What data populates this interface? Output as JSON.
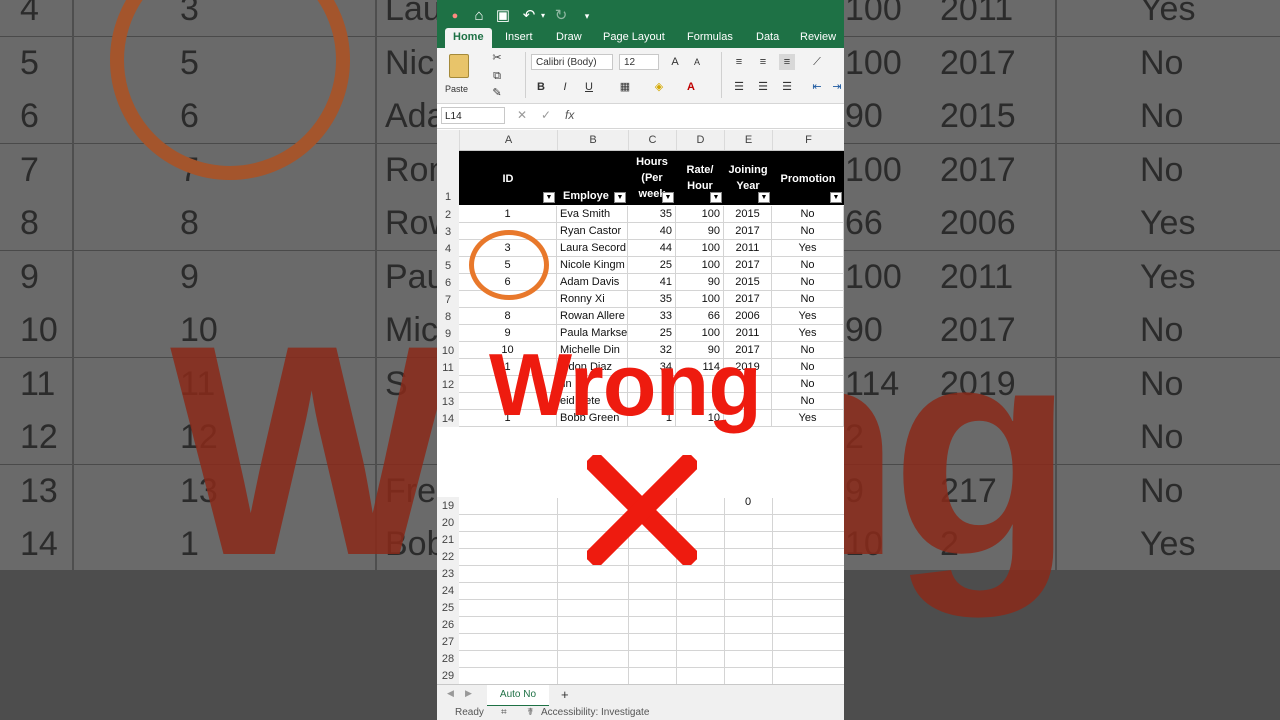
{
  "background": {
    "rows": [
      {
        "row": "4",
        "id": "3",
        "name": "Lau",
        "rate": "100",
        "year": "2011",
        "promo": "Yes"
      },
      {
        "row": "5",
        "id": "5",
        "name": "Nic",
        "rate": "100",
        "year": "2017",
        "promo": "No"
      },
      {
        "row": "6",
        "id": "6",
        "name": "Ada",
        "rate": "90",
        "year": "2015",
        "promo": "No"
      },
      {
        "row": "7",
        "id": "7",
        "name": "Ron",
        "rate": "100",
        "year": "2017",
        "promo": "No"
      },
      {
        "row": "8",
        "id": "8",
        "name": "Row",
        "rate": "66",
        "year": "2006",
        "promo": "Yes"
      },
      {
        "row": "9",
        "id": "9",
        "name": "Pau",
        "rate": "100",
        "year": "2011",
        "promo": "Yes"
      },
      {
        "row": "10",
        "id": "10",
        "name": "Mic",
        "rate": "90",
        "year": "2017",
        "promo": "No"
      },
      {
        "row": "11",
        "id": "11",
        "name": "S",
        "rate": "114",
        "year": "2019",
        "promo": "No"
      },
      {
        "row": "12",
        "id": "12",
        "name": "",
        "rate": "2",
        "year": "",
        "promo": "No"
      },
      {
        "row": "13",
        "id": "13",
        "name": "Fre",
        "rate": "9",
        "year": "217",
        "promo": "No"
      },
      {
        "row": "14",
        "id": "1",
        "name": "Bob",
        "rate": "10",
        "year": "2",
        "promo": "Yes"
      }
    ],
    "big_text": "Wrong"
  },
  "tabs": [
    "Home",
    "Insert",
    "Draw",
    "Page Layout",
    "Formulas",
    "Data",
    "Review"
  ],
  "ribbon": {
    "paste_label": "Paste",
    "font_name": "Calibri (Body)",
    "font_size": "12",
    "bold": "B",
    "italic": "I",
    "underline": "U"
  },
  "formula_bar": {
    "name_box": "L14",
    "fx": "fx"
  },
  "columns": [
    "A",
    "B",
    "C",
    "D",
    "E",
    "F"
  ],
  "header": {
    "id": "ID",
    "employee": "Employe",
    "hours_l1": "Hours",
    "hours_l2": "(Per",
    "hours_l3": "week",
    "rate_l1": "Rate/",
    "rate_l2": "Hour",
    "join_l1": "Joining",
    "join_l2": "Year",
    "promotion": "Promotion"
  },
  "row_numbers": [
    "1",
    "2",
    "3",
    "4",
    "5",
    "6",
    "7",
    "8",
    "9",
    "10",
    "11",
    "12",
    "13",
    "14",
    "19",
    "20",
    "21",
    "22",
    "23",
    "24",
    "25",
    "26",
    "27",
    "28",
    "29"
  ],
  "rows": [
    {
      "id": "1",
      "name": "Eva Smith",
      "hours": "35",
      "rate": "100",
      "year": "2015",
      "promo": "No"
    },
    {
      "id": "",
      "name": "Ryan Castor",
      "hours": "40",
      "rate": "90",
      "year": "2017",
      "promo": "No"
    },
    {
      "id": "3",
      "name": "Laura Secord",
      "hours": "44",
      "rate": "100",
      "year": "2011",
      "promo": "Yes"
    },
    {
      "id": "5",
      "name": "Nicole Kingm",
      "hours": "25",
      "rate": "100",
      "year": "2017",
      "promo": "No"
    },
    {
      "id": "6",
      "name": "Adam Davis",
      "hours": "41",
      "rate": "90",
      "year": "2015",
      "promo": "No"
    },
    {
      "id": "",
      "name": "Ronny Xi",
      "hours": "35",
      "rate": "100",
      "year": "2017",
      "promo": "No"
    },
    {
      "id": "8",
      "name": "Rowan Allere",
      "hours": "33",
      "rate": "66",
      "year": "2006",
      "promo": "Yes"
    },
    {
      "id": "9",
      "name": "Paula Markse",
      "hours": "25",
      "rate": "100",
      "year": "2011",
      "promo": "Yes"
    },
    {
      "id": "10",
      "name": "Michelle Din",
      "hours": "32",
      "rate": "90",
      "year": "2017",
      "promo": "No"
    },
    {
      "id": "1",
      "name": "eldon Diaz",
      "hours": "34",
      "rate": "114",
      "year": "2019",
      "promo": "No"
    },
    {
      "id": "",
      "name": "tin",
      "hours": "5",
      "rate": "",
      "year": "2",
      "promo": "No"
    },
    {
      "id": "",
      "name": "eid Pete",
      "hours": "",
      "rate": "9",
      "year": "7",
      "promo": "No"
    },
    {
      "id": "1",
      "name": "Bobb Green",
      "hours": "1",
      "rate": "10",
      "year": "2",
      "promo": "Yes"
    }
  ],
  "row19_value": "0",
  "overlay": {
    "text": "Wrong"
  },
  "sheet_tab": "Auto No",
  "add_sheet": "+",
  "status": {
    "ready": "Ready",
    "accessibility": "Accessibility: Investigate"
  },
  "colors": {
    "excel_green": "#1e7145",
    "overlay_red": "#ee1b0f",
    "circle_orange": "#e8782b"
  }
}
